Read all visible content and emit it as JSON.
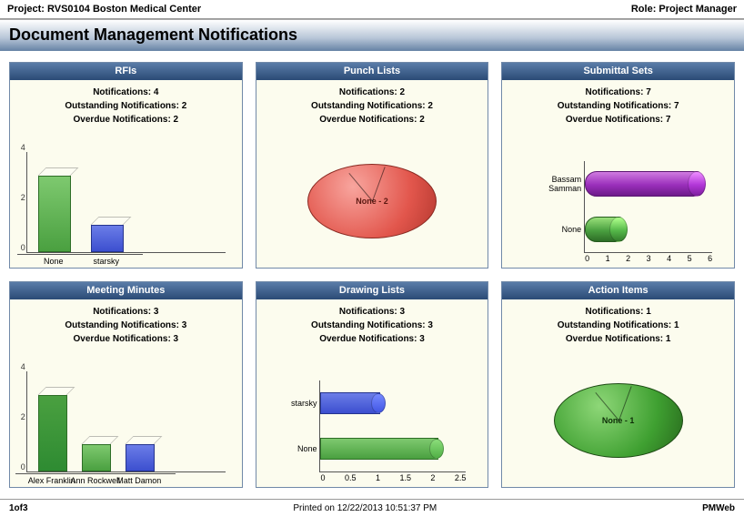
{
  "header": {
    "project": "Project: RVS0104 Boston Medical Center",
    "role": "Role: Project Manager",
    "page_title": "Document Management Notifications"
  },
  "panels": [
    {
      "key": "rfis",
      "title": "RFIs",
      "stats": {
        "notifications": "Notifications: 4",
        "outstanding": "Outstanding Notifications: 2",
        "overdue": "Overdue Notifications: 2"
      }
    },
    {
      "key": "punch",
      "title": "Punch Lists",
      "stats": {
        "notifications": "Notifications: 2",
        "outstanding": "Outstanding Notifications: 2",
        "overdue": "Overdue Notifications: 2"
      }
    },
    {
      "key": "submittal",
      "title": "Submittal Sets",
      "stats": {
        "notifications": "Notifications: 7",
        "outstanding": "Outstanding Notifications: 7",
        "overdue": "Overdue Notifications: 7"
      }
    },
    {
      "key": "meeting",
      "title": "Meeting Minutes",
      "stats": {
        "notifications": "Notifications: 3",
        "outstanding": "Outstanding Notifications: 3",
        "overdue": "Overdue Notifications: 3"
      }
    },
    {
      "key": "drawing",
      "title": "Drawing Lists",
      "stats": {
        "notifications": "Notifications: 3",
        "outstanding": "Outstanding Notifications: 3",
        "overdue": "Overdue Notifications: 3"
      }
    },
    {
      "key": "action",
      "title": "Action Items",
      "stats": {
        "notifications": "Notifications: 1",
        "outstanding": "Outstanding Notifications: 1",
        "overdue": "Overdue Notifications: 1"
      }
    }
  ],
  "chart_data": [
    {
      "panel": "rfis",
      "type": "bar",
      "orientation": "vertical",
      "categories": [
        "None",
        "starsky"
      ],
      "values": [
        3,
        1
      ],
      "colors": [
        "#4aa040",
        "#3c4fcf"
      ],
      "ylim": [
        0,
        4
      ],
      "yticks": [
        0,
        2,
        4
      ]
    },
    {
      "panel": "punch",
      "type": "pie",
      "series": [
        {
          "name": "None",
          "value": 2
        }
      ],
      "color": "#e2564c",
      "center_label": "None - 2"
    },
    {
      "panel": "submittal",
      "type": "bar",
      "orientation": "horizontal",
      "style": "cylinder",
      "categories": [
        "Bassam Samman",
        "None"
      ],
      "values": [
        6,
        2
      ],
      "colors": [
        "#9a2fbb",
        "#4aa040"
      ],
      "xlim": [
        0,
        6
      ],
      "xticks": [
        0,
        1,
        2,
        3,
        4,
        5,
        6
      ]
    },
    {
      "panel": "meeting",
      "type": "bar",
      "orientation": "vertical",
      "categories": [
        "Alex Franklin",
        "Ann Rockwell",
        "Matt Damon"
      ],
      "values": [
        3,
        1,
        1
      ],
      "colors": [
        "#2e8b32",
        "#4aa040",
        "#3c4fcf"
      ],
      "ylim": [
        0,
        4
      ],
      "yticks": [
        0,
        2,
        4
      ]
    },
    {
      "panel": "drawing",
      "type": "bar",
      "orientation": "horizontal",
      "categories": [
        "starsky",
        "None"
      ],
      "values": [
        1,
        2
      ],
      "colors": [
        "#3c4fcf",
        "#4aa040"
      ],
      "xlim": [
        0,
        2.5
      ],
      "xticks": [
        0,
        0.5,
        1,
        1.5,
        2,
        2.5
      ]
    },
    {
      "panel": "action",
      "type": "pie",
      "series": [
        {
          "name": "None",
          "value": 1
        }
      ],
      "color": "#3fa031",
      "center_label": "None - 1"
    }
  ],
  "footer": {
    "page": "1of3",
    "printed": "Printed on 12/22/2013 10:51:37 PM",
    "brand": "PMWeb"
  }
}
